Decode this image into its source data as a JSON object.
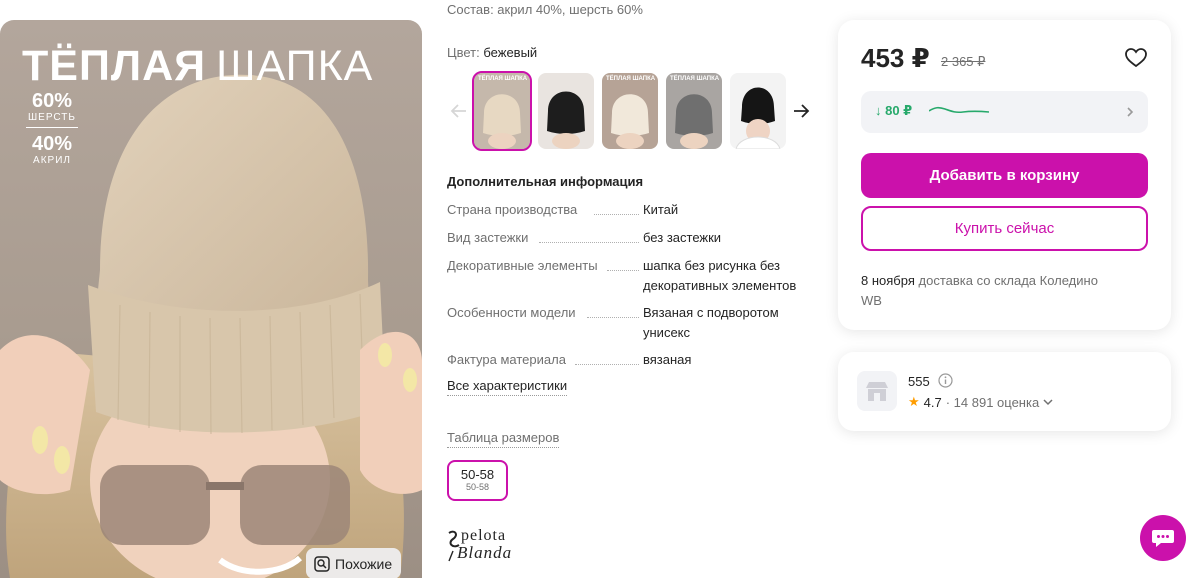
{
  "photo": {
    "promo_title_bold": "ТЁПЛАЯ",
    "promo_title_thin": "ШАПКА",
    "composition": [
      {
        "pct": "60%",
        "name": "ШЕРСТЬ"
      },
      {
        "pct": "40%",
        "name": "АКРИЛ"
      }
    ],
    "similar_label": "Похожие"
  },
  "details": {
    "composition": "Состав: акрил 40%, шерсть 60%",
    "color_key": "Цвет:",
    "color_value": "бежевый",
    "thumb_text": "ТЁПЛАЯ ШАПКА",
    "add_info_title": "Дополнительная информация",
    "specs": [
      {
        "key": "Страна производства",
        "value": "Китай"
      },
      {
        "key": "Вид застежки",
        "value": "без застежки"
      },
      {
        "key": "Декоративные элементы",
        "value": "шапка без рисунка без декоративных элементов"
      },
      {
        "key": "Особенности модели",
        "value": "Вязаная с подворотом унисекс"
      },
      {
        "key": "Фактура материала",
        "value": "вязаная"
      }
    ],
    "all_chars": "Все характеристики",
    "size_table": "Таблица размеров",
    "size_main": "50-58",
    "size_sub": "50-58",
    "brand_line1": "pelota",
    "brand_line2": "Blanda"
  },
  "buy": {
    "price": "453 ₽",
    "old_price": "2 365 ₽",
    "price_drop": "↓ 80 ₽",
    "add_to_cart": "Добавить в корзину",
    "buy_now": "Купить сейчас",
    "delivery_date": "8 ноября",
    "delivery_text": "доставка со склада Коледино",
    "delivery_wb": "WB"
  },
  "seller": {
    "name": "555",
    "rating": "4.7",
    "reviews": "· 14 891 оценка"
  },
  "colors": {
    "accent": "#cb11ab",
    "green": "#27a96b",
    "muted": "#707070"
  }
}
